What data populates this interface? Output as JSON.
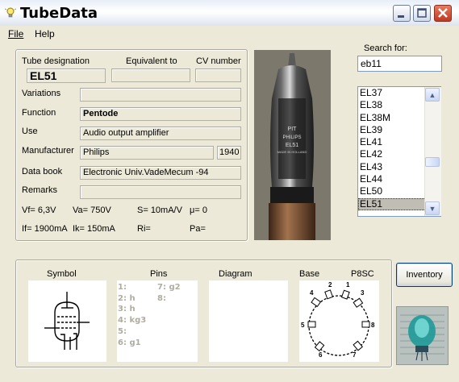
{
  "window": {
    "title": "TubeData"
  },
  "menu": {
    "file": "File",
    "help": "Help"
  },
  "labels": {
    "tube_designation": "Tube designation",
    "equivalent_to": "Equivalent to",
    "cv_number": "CV number",
    "variations": "Variations",
    "function": "Function",
    "use": "Use",
    "manufacturer": "Manufacturer",
    "data_book": "Data book",
    "remarks": "Remarks"
  },
  "values": {
    "tube_designation": "EL51",
    "equivalent_to": "",
    "cv_number": "",
    "variations": "",
    "function": "Pentode",
    "use": "Audio output amplifier",
    "manufacturer": "Philips",
    "year": "1940",
    "data_book": "Electronic Univ.VadeMecum -94",
    "remarks": ""
  },
  "params": {
    "vf": "Vf= 6,3V",
    "va": "Va= 750V",
    "s": "S= 10mA/V",
    "mu": "μ=    0",
    "if": "If= 1900mA",
    "ik": "Ik=  150mA",
    "ri": "Ri=",
    "pa": "Pa="
  },
  "search": {
    "label": "Search for:",
    "value": "eb11"
  },
  "tube_list": [
    "EL37",
    "EL38",
    "EL38M",
    "EL39",
    "EL41",
    "EL42",
    "EL43",
    "EL44",
    "EL50",
    "EL51"
  ],
  "selected_tube": "EL51",
  "photo_text": {
    "line1": "PIT",
    "line2": "PHILIPS",
    "line3": "EL51",
    "line4": "MADE IN HOLLAND"
  },
  "bottom": {
    "symbol_label": "Symbol",
    "pins_label": "Pins",
    "diagram_label": "Diagram",
    "base_label": "Base",
    "base_type": "P8SC",
    "pins_left": [
      "1:",
      "2: h",
      "3: h",
      "4: kg3",
      "5:",
      "6: g1"
    ],
    "pins_right": [
      "7: g2",
      "8:"
    ],
    "base_pin_numbers": [
      "1",
      "2",
      "3",
      "4",
      "5",
      "6",
      "7",
      "8"
    ]
  },
  "inventory_button": "Inventory",
  "colors": {
    "window_bg": "#ece9d8",
    "selection_bg": "#c0bdb4",
    "close_button": "#c0391f"
  }
}
